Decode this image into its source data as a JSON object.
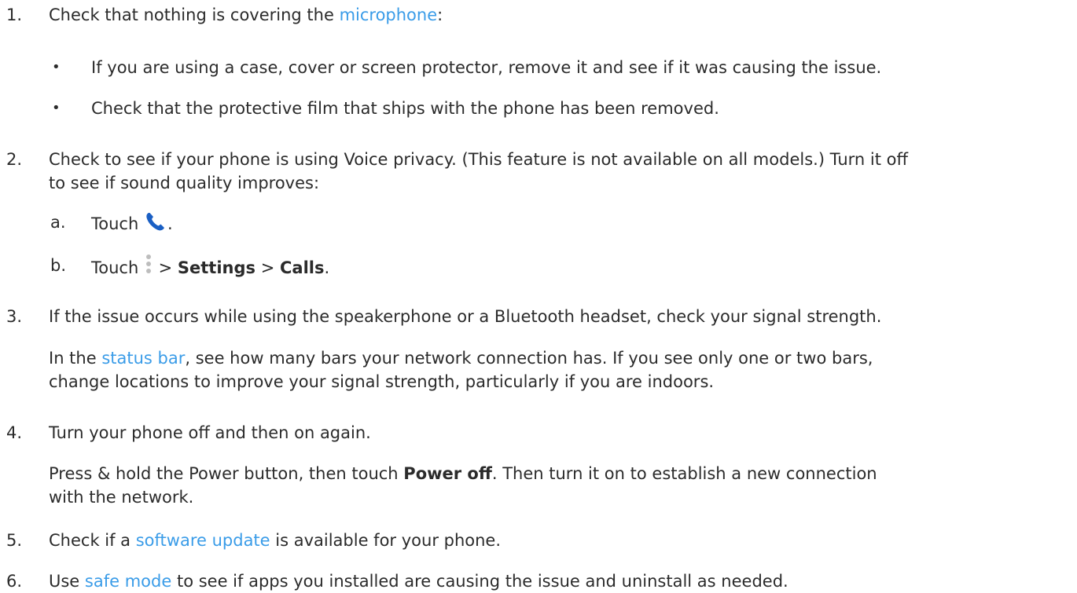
{
  "steps": {
    "s1": {
      "num": "1.",
      "pre": "Check that nothing is covering the ",
      "link": "microphone",
      "post": ":",
      "bullets": [
        "If you are using a case, cover or screen protector, remove it and see if it was causing the issue.",
        "Check that the protective film that ships with the phone has been removed."
      ]
    },
    "s2": {
      "num": "2.",
      "line1": "Check to see if your phone is using Voice privacy. (This feature is not available on all models.) Turn it off",
      "line2": "to see if sound quality improves:",
      "a": {
        "letter": "a.",
        "pre": "Touch ",
        "post": "."
      },
      "b": {
        "letter": "b.",
        "pre": "Touch ",
        "sep1": " > ",
        "bold1": "Settings",
        "sep2": " > ",
        "bold2": "Calls",
        "post": "."
      }
    },
    "s3": {
      "num": "3.",
      "line1": "If the issue occurs while using the speakerphone or a Bluetooth headset, check your signal strength.",
      "p_pre": "In the ",
      "p_link": "status bar",
      "p_post": ", see how many bars your network connection has. If you see only one or two bars,",
      "p_line2": "change locations to improve your signal strength, particularly if you are indoors."
    },
    "s4": {
      "num": "4.",
      "line1": "Turn your phone off and then on again.",
      "p_pre": "Press & hold the Power button, then touch ",
      "p_bold": "Power off",
      "p_post": ". Then turn it on to establish a new connection",
      "p_line2": "with the network."
    },
    "s5": {
      "num": "5.",
      "pre": "Check if a ",
      "link": "software update",
      "post": " is available for your phone."
    },
    "s6": {
      "num": "6.",
      "pre": "Use ",
      "link": "safe mode",
      "post": " to see if apps you installed are causing the issue and uninstall as needed."
    }
  },
  "icons": {
    "phone": "phone-icon",
    "menu": "more-vertical-icon"
  },
  "colors": {
    "text": "#2b2b2b",
    "link": "#3a9ce8",
    "phone_icon": "#1a5fc4",
    "menu_icon": "#bdbdbd"
  }
}
